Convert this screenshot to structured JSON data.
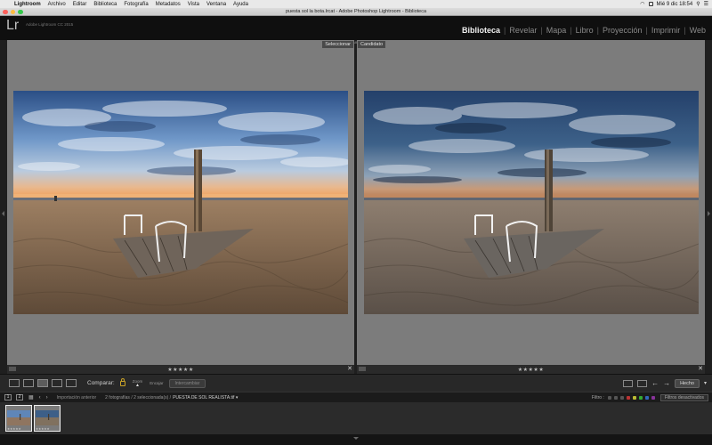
{
  "menubar": {
    "items": [
      "Lightroom",
      "Archivo",
      "Editar",
      "Biblioteca",
      "Fotografía",
      "Metadatos",
      "Vista",
      "Ventana",
      "Ayuda"
    ],
    "clock": "Mié 9 dic  18:54"
  },
  "window": {
    "title": "puesta sol la bota.lrcat - Adobe Photoshop Lightroom - Biblioteca"
  },
  "identity": {
    "logo": "Lr",
    "version": "Adobe Lightroom CC 2015"
  },
  "modules": [
    "Biblioteca",
    "Revelar",
    "Mapa",
    "Libro",
    "Proyección",
    "Imprimir",
    "Web"
  ],
  "compare": {
    "left_tag": "Seleccionar",
    "right_tag": "Candidato",
    "left_stars": "★★★★★",
    "right_stars": "★★★★★"
  },
  "toolbar": {
    "compare_label": "Comparar:",
    "zoom_label": "Zoom",
    "fit_label": "Encajar",
    "swap_label": "Intercambiar",
    "done_label": "Hecho"
  },
  "filmbar": {
    "page1": "1",
    "page2": "2",
    "import_label": "Importación anterior",
    "count": "2 fotografías / 2 seleccionada(s) /",
    "filename": "PUESTA DE SOL REALISTA.tif ▾",
    "filter_label": "Filtro :",
    "filter_state": "Filtros desactivados"
  },
  "filmstrip": {
    "thumb_stars": "★★★★★"
  },
  "colors": {
    "active_module": "#f0f0f0",
    "inactive_module": "#8a8a8a",
    "lock": "#c9a227"
  }
}
